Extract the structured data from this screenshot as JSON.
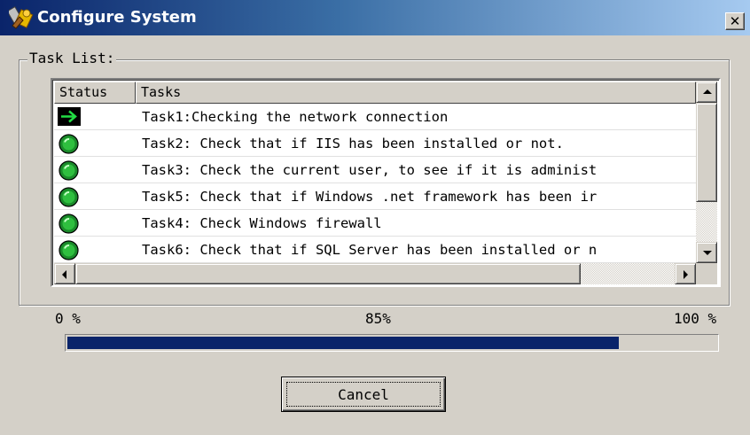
{
  "window": {
    "title": "Configure System",
    "close_glyph": "✕",
    "titlebar_colors": [
      "#0a246a",
      "#a6caf0"
    ]
  },
  "group": {
    "legend": "Task List:"
  },
  "list": {
    "columns": [
      "Status",
      "Tasks"
    ],
    "rows": [
      {
        "status_icon": "arrow-right-icon",
        "task": "Task1:Checking the network connection"
      },
      {
        "status_icon": "check-circle-icon",
        "task": "Task2: Check that if IIS has been installed or not."
      },
      {
        "status_icon": "check-circle-icon",
        "task": "Task3: Check the current user, to see if it is administ"
      },
      {
        "status_icon": "check-circle-icon",
        "task": "Task5: Check that if Windows .net framework has been ir"
      },
      {
        "status_icon": "check-circle-icon",
        "task": "Task4: Check Windows firewall"
      },
      {
        "status_icon": "check-circle-icon",
        "task": "Task6: Check that if SQL Server has been installed or n"
      }
    ]
  },
  "progress": {
    "min_label": "0 %",
    "current_label": "85%",
    "max_label": "100 %",
    "value_fraction": 0.85,
    "fill_color": "#0a246a"
  },
  "buttons": {
    "cancel_label": "Cancel"
  }
}
